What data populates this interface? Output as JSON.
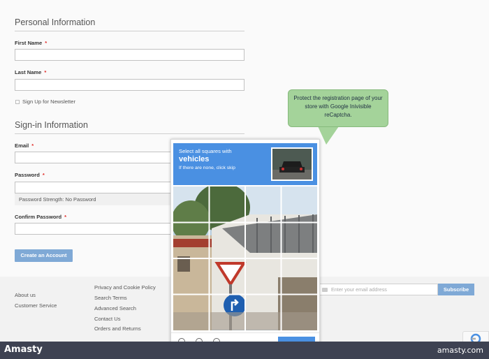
{
  "form": {
    "personal_title": "Personal Information",
    "first_name_label": "First Name",
    "last_name_label": "Last Name",
    "required_mark": "*",
    "newsletter_label": "Sign Up for Newsletter",
    "signin_title": "Sign-in Information",
    "email_label": "Email",
    "password_label": "Password",
    "password_strength": "Password Strength: No Password",
    "confirm_label": "Confirm Password",
    "create_button": "Create an Account"
  },
  "footer": {
    "col1": [
      "About us",
      "Customer Service"
    ],
    "col2": [
      "Privacy and Cookie Policy",
      "Search Terms",
      "Advanced Search",
      "Contact Us",
      "Orders and Returns"
    ],
    "newsletter_placeholder": "Enter your email address",
    "subscribe_label": "Subscribe"
  },
  "callout": {
    "text": "Protect the registration page of your store with Google Inivisible reCaptcha."
  },
  "captcha": {
    "line1": "Select all squares with",
    "target": "vehicles",
    "line3": "If there are none, click skip"
  },
  "bottom_bar": {
    "brand": "Amasty",
    "site": "amasty.com"
  },
  "colors": {
    "accent": "#7fa9d6",
    "captcha_blue": "#4a90e2",
    "callout_green": "#a4d39a",
    "bar": "#3e4252"
  }
}
